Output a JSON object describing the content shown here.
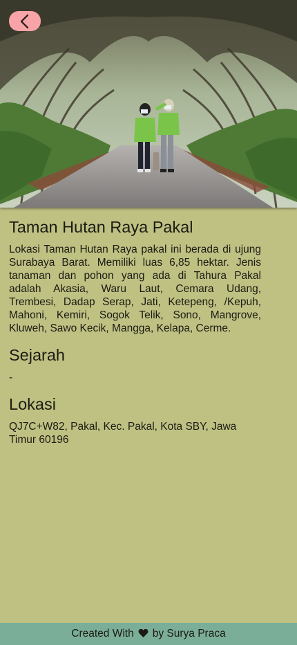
{
  "place": {
    "name": "Taman Hutan Raya Pakal",
    "description": "Lokasi Taman Hutan Raya pakal ini berada di ujung Surabaya Barat. Memiliki luas 6,85 hektar. Jenis tanaman dan pohon yang ada di Tahura Pakal adalah Akasia, Waru Laut, Cemara Udang, Trembesi, Dadap Serap, Jati, Ketepeng, /Kepuh, Mahoni, Kemiri, Sogok Telik, Sono, Mangrove, Kluweh, Sawo Kecik, Mangga, Kelapa, Cerme."
  },
  "sections": {
    "history_title": "Sejarah",
    "history_text": "-",
    "location_title": "Lokasi",
    "location_text": "QJ7C+W82, Pakal, Kec. Pakal, Kota SBY, Jawa Timur 60196"
  },
  "footer": {
    "prefix": "Created With",
    "heart_icon": "heart-icon",
    "suffix": "by Surya Praca"
  },
  "icons": {
    "back": "chevron-left-icon"
  },
  "colors": {
    "background": "#bfc183",
    "footer": "#7bae98",
    "back_button": "#f7a3a8"
  }
}
